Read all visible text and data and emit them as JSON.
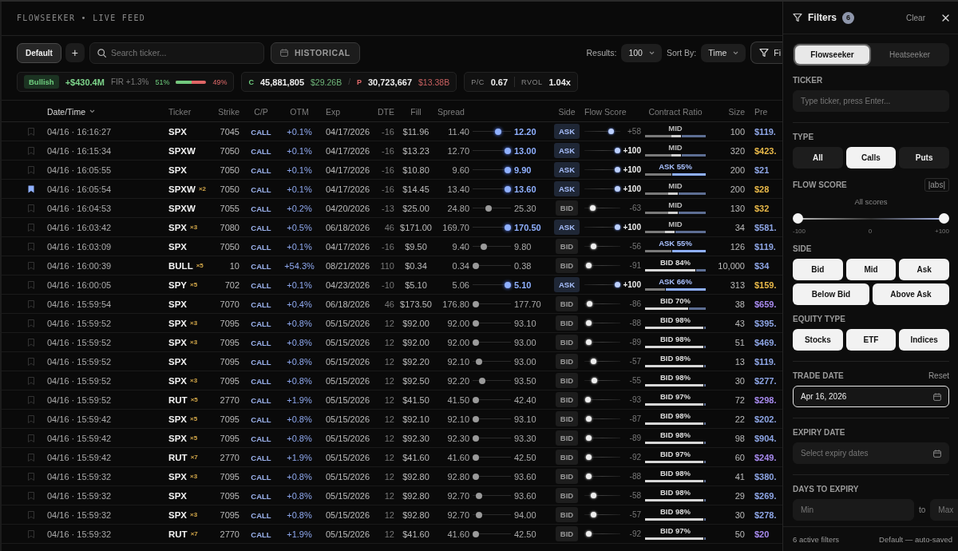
{
  "header": {
    "title": "FLOWSEEKER • LIVE FEED"
  },
  "toolbar": {
    "presets": [
      {
        "label": "Default",
        "selected": true
      }
    ],
    "add_button": "+",
    "search": {
      "placeholder": "Search ticker..."
    },
    "historical_button": "HISTORICAL",
    "results": {
      "label": "Results:",
      "value": "100"
    },
    "sort": {
      "label": "Sort By:",
      "value": "Time"
    },
    "filter_button": "Fi"
  },
  "summary": {
    "sentiment": "Bullish",
    "net_premium": "+$430.4M",
    "fir": "FIR +1.3%",
    "bull_pct": "51%",
    "level": 0.51,
    "bear_pct": "49%"
  },
  "volume": {
    "call_label": "C",
    "call_volume": "45,881,805",
    "call_premium": "$29.26B",
    "separator": "/",
    "put_label": "P",
    "put_volume": "30,723,667",
    "put_premium": "$13.38B"
  },
  "ratios": [
    {
      "label": "P/C",
      "value": "0.67"
    },
    {
      "label": "RVOL",
      "value": "1.04x"
    }
  ],
  "table": {
    "columns": [
      {
        "label": "Date/Time",
        "sorted": true
      },
      {
        "label": "Ticker",
        "sorted": false
      },
      {
        "label": "Strike",
        "sorted": false
      },
      {
        "label": "C/P",
        "sorted": false
      },
      {
        "label": "OTM",
        "sorted": false
      },
      {
        "label": "Exp",
        "sorted": false
      },
      {
        "label": "DTE",
        "sorted": false
      },
      {
        "label": "Fill",
        "sorted": false
      },
      {
        "label": "Spread",
        "sorted": false
      },
      {
        "label": "Side",
        "sorted": false
      },
      {
        "label": "Flow Score",
        "sorted": false
      },
      {
        "label": "Contract Ratio",
        "sorted": false
      },
      {
        "label": "Size",
        "sorted": false
      },
      {
        "label": "Pre",
        "sorted": false
      }
    ],
    "rows": [
      {
        "bookmarked": false,
        "datetime": "04/16 · 16:16:27",
        "ticker": "SPX",
        "strike": "7045",
        "type": "CALL",
        "otm": "+0.1%",
        "exp": "04/17/2026",
        "dte": "-16",
        "fill": "$11.96",
        "bid": "11.40",
        "ask": "12.20",
        "spread": {
          "level": 0.7
        },
        "side": {
          "label": "ASK",
          "kind": "ask"
        },
        "flow": {
          "score": "+58",
          "level": 0.79
        },
        "ratio": {
          "label": "MID",
          "kind": "mid",
          "level": 0.6
        },
        "size": "100",
        "premium": {
          "text": "$119.",
          "color": "#8ea6e6"
        }
      },
      {
        "bookmarked": false,
        "datetime": "04/16 · 16:15:34",
        "ticker": "SPXW",
        "strike": "7050",
        "type": "CALL",
        "otm": "+0.1%",
        "exp": "04/17/2026",
        "dte": "-16",
        "fill": "$13.23",
        "bid": "12.70",
        "ask": "13.00",
        "spread": {
          "level": 1
        },
        "side": {
          "label": "ASK",
          "kind": "ask"
        },
        "flow": {
          "score": "+100",
          "level": 1
        },
        "ratio": {
          "label": "MID",
          "kind": "mid",
          "level": 0.6
        },
        "size": "320",
        "premium": {
          "text": "$423.",
          "color": "#e9b949"
        }
      },
      {
        "bookmarked": false,
        "datetime": "04/16 · 16:05:55",
        "ticker": "SPX",
        "strike": "7050",
        "type": "CALL",
        "otm": "+0.1%",
        "exp": "04/17/2026",
        "dte": "-16",
        "fill": "$10.80",
        "bid": "9.60",
        "ask": "9.90",
        "spread": {
          "level": 1
        },
        "side": {
          "label": "ASK",
          "kind": "ask"
        },
        "flow": {
          "score": "+100",
          "level": 1
        },
        "ratio": {
          "label": "ASK 55%",
          "kind": "ask",
          "level": 0.45
        },
        "size": "200",
        "premium": {
          "text": "$21",
          "color": "#8ea6e6"
        }
      },
      {
        "bookmarked": true,
        "datetime": "04/16 · 16:05:54",
        "ticker": "SPXW",
        "count": "×2",
        "strike": "7050",
        "type": "CALL",
        "otm": "+0.1%",
        "exp": "04/17/2026",
        "dte": "-16",
        "fill": "$14.45",
        "bid": "13.40",
        "ask": "13.60",
        "spread": {
          "level": 1
        },
        "side": {
          "label": "ASK",
          "kind": "ask"
        },
        "flow": {
          "score": "+100",
          "level": 1
        },
        "ratio": {
          "label": "MID",
          "kind": "mid",
          "level": 0.55
        },
        "size": "200",
        "premium": {
          "text": "$28",
          "color": "#e9b949"
        }
      },
      {
        "bookmarked": false,
        "datetime": "04/16 · 16:04:53",
        "ticker": "SPXW",
        "strike": "7055",
        "type": "CALL",
        "otm": "+0.2%",
        "exp": "04/20/2026",
        "dte": "-13",
        "fill": "$25.00",
        "bid": "24.80",
        "ask": "25.30",
        "spread": {
          "level": 0.4
        },
        "side": {
          "label": "BID",
          "kind": "bid"
        },
        "flow": {
          "score": "-63",
          "level": 0.185
        },
        "ratio": {
          "label": "MID",
          "kind": "mid",
          "level": 0.55
        },
        "size": "130",
        "premium": {
          "text": "$32",
          "color": "#e9b949"
        }
      },
      {
        "bookmarked": false,
        "datetime": "04/16 · 16:03:42",
        "ticker": "SPX",
        "count": "×3",
        "strike": "7080",
        "type": "CALL",
        "otm": "+0.5%",
        "exp": "06/18/2026",
        "dte": "46",
        "fill": "$171.00",
        "bid": "169.70",
        "ask": "170.50",
        "spread": {
          "level": 1
        },
        "side": {
          "label": "ASK",
          "kind": "ask"
        },
        "flow": {
          "score": "+100",
          "level": 1
        },
        "ratio": {
          "label": "MID",
          "kind": "mid",
          "level": 0.5
        },
        "size": "34",
        "premium": {
          "text": "$581.",
          "color": "#8ea6e6"
        }
      },
      {
        "bookmarked": false,
        "datetime": "04/16 · 16:03:09",
        "ticker": "SPX",
        "strike": "7050",
        "type": "CALL",
        "otm": "+0.1%",
        "exp": "04/17/2026",
        "dte": "-16",
        "fill": "$9.50",
        "bid": "9.40",
        "ask": "9.80",
        "spread": {
          "level": 0.25
        },
        "side": {
          "label": "BID",
          "kind": "bid"
        },
        "flow": {
          "score": "-56",
          "level": 0.22
        },
        "ratio": {
          "label": "ASK 55%",
          "kind": "ask",
          "level": 0.45
        },
        "size": "126",
        "premium": {
          "text": "$119.",
          "color": "#8ea6e6"
        }
      },
      {
        "bookmarked": false,
        "datetime": "04/16 · 16:00:39",
        "ticker": "BULL",
        "count": "×5",
        "strike": "10",
        "type": "CALL",
        "otm": "+54.3%",
        "exp": "08/21/2026",
        "dte": "110",
        "fill": "$0.34",
        "bid": "0.34",
        "ask": "0.38",
        "spread": {
          "level": 0
        },
        "side": {
          "label": "BID",
          "kind": "bid"
        },
        "flow": {
          "score": "-91",
          "level": 0.045
        },
        "ratio": {
          "label": "BID 84%",
          "kind": "bid",
          "level": 0.84
        },
        "size": "10,000",
        "premium": {
          "text": "$34",
          "color": "#8ea6e6"
        }
      },
      {
        "bookmarked": false,
        "datetime": "04/16 · 16:00:05",
        "ticker": "SPY",
        "count": "×5",
        "strike": "702",
        "type": "CALL",
        "otm": "+0.1%",
        "exp": "04/23/2026",
        "dte": "-10",
        "fill": "$5.10",
        "bid": "5.06",
        "ask": "5.10",
        "spread": {
          "level": 1
        },
        "side": {
          "label": "ASK",
          "kind": "ask"
        },
        "flow": {
          "score": "+100",
          "level": 1
        },
        "ratio": {
          "label": "ASK 66%",
          "kind": "ask",
          "level": 0.34
        },
        "size": "313",
        "premium": {
          "text": "$159.",
          "color": "#e9b949"
        }
      },
      {
        "bookmarked": false,
        "datetime": "04/16 · 15:59:54",
        "ticker": "SPX",
        "strike": "7070",
        "type": "CALL",
        "otm": "+0.4%",
        "exp": "06/18/2026",
        "dte": "46",
        "fill": "$173.50",
        "bid": "176.80",
        "ask": "177.70",
        "spread": {
          "level": 0
        },
        "side": {
          "label": "BID",
          "kind": "bid"
        },
        "flow": {
          "score": "-86",
          "level": 0.07
        },
        "ratio": {
          "label": "BID 70%",
          "kind": "bid",
          "level": 0.72
        },
        "size": "38",
        "premium": {
          "text": "$659.",
          "color": "#a98bf0"
        }
      },
      {
        "bookmarked": false,
        "datetime": "04/16 · 15:59:52",
        "ticker": "SPX",
        "count": "×3",
        "strike": "7095",
        "type": "CALL",
        "otm": "+0.8%",
        "exp": "05/15/2026",
        "dte": "12",
        "fill": "$92.00",
        "bid": "92.00",
        "ask": "93.10",
        "spread": {
          "level": 0
        },
        "side": {
          "label": "BID",
          "kind": "bid"
        },
        "flow": {
          "score": "-88",
          "level": 0.06
        },
        "ratio": {
          "label": "BID 98%",
          "kind": "bid",
          "level": 0.98
        },
        "size": "43",
        "premium": {
          "text": "$395.",
          "color": "#8ea6e6"
        }
      },
      {
        "bookmarked": false,
        "datetime": "04/16 · 15:59:52",
        "ticker": "SPX",
        "count": "×3",
        "strike": "7095",
        "type": "CALL",
        "otm": "+0.8%",
        "exp": "05/15/2026",
        "dte": "12",
        "fill": "$92.00",
        "bid": "92.00",
        "ask": "93.00",
        "spread": {
          "level": 0
        },
        "side": {
          "label": "BID",
          "kind": "bid"
        },
        "flow": {
          "score": "-89",
          "level": 0.055
        },
        "ratio": {
          "label": "BID 98%",
          "kind": "bid",
          "level": 0.98
        },
        "size": "51",
        "premium": {
          "text": "$469.",
          "color": "#8ea6e6"
        }
      },
      {
        "bookmarked": false,
        "datetime": "04/16 · 15:59:52",
        "ticker": "SPX",
        "strike": "7095",
        "type": "CALL",
        "otm": "+0.8%",
        "exp": "05/15/2026",
        "dte": "12",
        "fill": "$92.20",
        "bid": "92.10",
        "ask": "93.00",
        "spread": {
          "level": 0.1
        },
        "side": {
          "label": "BID",
          "kind": "bid"
        },
        "flow": {
          "score": "-57",
          "level": 0.215
        },
        "ratio": {
          "label": "BID 98%",
          "kind": "bid",
          "level": 0.98
        },
        "size": "13",
        "premium": {
          "text": "$119.",
          "color": "#8ea6e6"
        }
      },
      {
        "bookmarked": false,
        "datetime": "04/16 · 15:59:52",
        "ticker": "SPX",
        "count": "×3",
        "strike": "7095",
        "type": "CALL",
        "otm": "+0.8%",
        "exp": "05/15/2026",
        "dte": "12",
        "fill": "$92.50",
        "bid": "92.20",
        "ask": "93.50",
        "spread": {
          "level": 0.2
        },
        "side": {
          "label": "BID",
          "kind": "bid"
        },
        "flow": {
          "score": "-55",
          "level": 0.225
        },
        "ratio": {
          "label": "BID 98%",
          "kind": "bid",
          "level": 0.98
        },
        "size": "30",
        "premium": {
          "text": "$277.",
          "color": "#8ea6e6"
        }
      },
      {
        "bookmarked": false,
        "datetime": "04/16 · 15:59:52",
        "ticker": "RUT",
        "count": "×5",
        "strike": "2770",
        "type": "CALL",
        "otm": "+1.9%",
        "exp": "05/15/2026",
        "dte": "12",
        "fill": "$41.50",
        "bid": "41.50",
        "ask": "42.40",
        "spread": {
          "level": 0
        },
        "side": {
          "label": "BID",
          "kind": "bid"
        },
        "flow": {
          "score": "-93",
          "level": 0.035
        },
        "ratio": {
          "label": "BID 97%",
          "kind": "bid",
          "level": 0.97
        },
        "size": "72",
        "premium": {
          "text": "$298.",
          "color": "#a98bf0"
        }
      },
      {
        "bookmarked": false,
        "datetime": "04/16 · 15:59:42",
        "ticker": "SPX",
        "count": "×5",
        "strike": "7095",
        "type": "CALL",
        "otm": "+0.8%",
        "exp": "05/15/2026",
        "dte": "12",
        "fill": "$92.10",
        "bid": "92.10",
        "ask": "93.10",
        "spread": {
          "level": 0
        },
        "side": {
          "label": "BID",
          "kind": "bid"
        },
        "flow": {
          "score": "-87",
          "level": 0.065
        },
        "ratio": {
          "label": "BID 98%",
          "kind": "bid",
          "level": 0.98
        },
        "size": "22",
        "premium": {
          "text": "$202.",
          "color": "#8ea6e6"
        }
      },
      {
        "bookmarked": false,
        "datetime": "04/16 · 15:59:42",
        "ticker": "SPX",
        "count": "×5",
        "strike": "7095",
        "type": "CALL",
        "otm": "+0.8%",
        "exp": "05/15/2026",
        "dte": "12",
        "fill": "$92.30",
        "bid": "92.30",
        "ask": "93.30",
        "spread": {
          "level": 0
        },
        "side": {
          "label": "BID",
          "kind": "bid"
        },
        "flow": {
          "score": "-89",
          "level": 0.055
        },
        "ratio": {
          "label": "BID 98%",
          "kind": "bid",
          "level": 0.98
        },
        "size": "98",
        "premium": {
          "text": "$904.",
          "color": "#8ea6e6"
        }
      },
      {
        "bookmarked": false,
        "datetime": "04/16 · 15:59:42",
        "ticker": "RUT",
        "count": "×7",
        "strike": "2770",
        "type": "CALL",
        "otm": "+1.9%",
        "exp": "05/15/2026",
        "dte": "12",
        "fill": "$41.60",
        "bid": "41.60",
        "ask": "42.50",
        "spread": {
          "level": 0
        },
        "side": {
          "label": "BID",
          "kind": "bid"
        },
        "flow": {
          "score": "-92",
          "level": 0.04
        },
        "ratio": {
          "label": "BID 97%",
          "kind": "bid",
          "level": 0.97
        },
        "size": "60",
        "premium": {
          "text": "$249.",
          "color": "#a98bf0"
        }
      },
      {
        "bookmarked": false,
        "datetime": "04/16 · 15:59:32",
        "ticker": "SPX",
        "count": "×3",
        "strike": "7095",
        "type": "CALL",
        "otm": "+0.8%",
        "exp": "05/15/2026",
        "dte": "12",
        "fill": "$92.80",
        "bid": "92.80",
        "ask": "93.60",
        "spread": {
          "level": 0
        },
        "side": {
          "label": "BID",
          "kind": "bid"
        },
        "flow": {
          "score": "-88",
          "level": 0.06
        },
        "ratio": {
          "label": "BID 98%",
          "kind": "bid",
          "level": 0.98
        },
        "size": "41",
        "premium": {
          "text": "$380.",
          "color": "#8ea6e6"
        }
      },
      {
        "bookmarked": false,
        "datetime": "04/16 · 15:59:32",
        "ticker": "SPX",
        "strike": "7095",
        "type": "CALL",
        "otm": "+0.8%",
        "exp": "05/15/2026",
        "dte": "12",
        "fill": "$92.80",
        "bid": "92.70",
        "ask": "93.60",
        "spread": {
          "level": 0.1
        },
        "side": {
          "label": "BID",
          "kind": "bid"
        },
        "flow": {
          "score": "-58",
          "level": 0.21
        },
        "ratio": {
          "label": "BID 98%",
          "kind": "bid",
          "level": 0.98
        },
        "size": "29",
        "premium": {
          "text": "$269.",
          "color": "#8ea6e6"
        }
      },
      {
        "bookmarked": false,
        "datetime": "04/16 · 15:59:32",
        "ticker": "SPX",
        "count": "×3",
        "strike": "7095",
        "type": "CALL",
        "otm": "+0.8%",
        "exp": "05/15/2026",
        "dte": "12",
        "fill": "$92.80",
        "bid": "92.70",
        "ask": "94.00",
        "spread": {
          "level": 0.1
        },
        "side": {
          "label": "BID",
          "kind": "bid"
        },
        "flow": {
          "score": "-57",
          "level": 0.215
        },
        "ratio": {
          "label": "BID 98%",
          "kind": "bid",
          "level": 0.98
        },
        "size": "30",
        "premium": {
          "text": "$278.",
          "color": "#8ea6e6"
        }
      },
      {
        "bookmarked": false,
        "datetime": "04/16 · 15:59:32",
        "ticker": "RUT",
        "count": "×7",
        "strike": "2770",
        "type": "CALL",
        "otm": "+1.9%",
        "exp": "05/15/2026",
        "dte": "12",
        "fill": "$41.60",
        "bid": "41.60",
        "ask": "42.50",
        "spread": {
          "level": 0
        },
        "side": {
          "label": "BID",
          "kind": "bid"
        },
        "flow": {
          "score": "-92",
          "level": 0.04
        },
        "ratio": {
          "label": "BID 97%",
          "kind": "bid",
          "level": 0.97
        },
        "size": "50",
        "premium": {
          "text": "$20",
          "color": "#a98bf0"
        }
      }
    ]
  },
  "filters": {
    "title": "Filters",
    "count": "6",
    "clear": "Clear",
    "modes": [
      {
        "label": "Flowseeker",
        "selected": true
      },
      {
        "label": "Heatseeker",
        "selected": false
      }
    ],
    "sections": [
      {
        "kind": "text",
        "label": "TICKER",
        "placeholder": "Type ticker, press Enter...",
        "divider": true
      },
      {
        "kind": "choices",
        "label": "TYPE",
        "divider": false,
        "options": [
          {
            "label": "All",
            "selected": false
          },
          {
            "label": "Calls",
            "selected": true
          },
          {
            "label": "Puts",
            "selected": false
          }
        ]
      },
      {
        "kind": "range",
        "label": "FLOW SCORE",
        "toggle": "|abs|",
        "caption": "All scores",
        "low": {
          "level": 0
        },
        "high": {
          "level": 1
        },
        "ticks": [
          "-100",
          "0",
          "+100"
        ],
        "divider": false
      },
      {
        "kind": "choices",
        "label": "SIDE",
        "divider": false,
        "options": [
          {
            "label": "Bid",
            "selected": true
          },
          {
            "label": "Mid",
            "selected": true
          },
          {
            "label": "Ask",
            "selected": true
          },
          {
            "label": "Below Bid",
            "selected": true
          },
          {
            "label": "Above Ask",
            "selected": true
          }
        ]
      },
      {
        "kind": "choices",
        "label": "EQUITY TYPE",
        "divider": true,
        "options": [
          {
            "label": "Stocks",
            "selected": true
          },
          {
            "label": "ETF",
            "selected": true
          },
          {
            "label": "Indices",
            "selected": true
          }
        ]
      },
      {
        "kind": "date",
        "label": "TRADE DATE",
        "action": "Reset",
        "value": "Apr 16, 2026",
        "divider": true
      },
      {
        "kind": "date",
        "label": "EXPIRY DATE",
        "placeholder": "Select expiry dates",
        "divider": true
      },
      {
        "kind": "between",
        "label": "DAYS TO EXPIRY",
        "min_placeholder": "Min",
        "joiner": "to",
        "max_placeholder": "Max",
        "divider": false
      }
    ],
    "footer": {
      "status": "6 active filters",
      "preset": "Default — auto-saved"
    }
  }
}
